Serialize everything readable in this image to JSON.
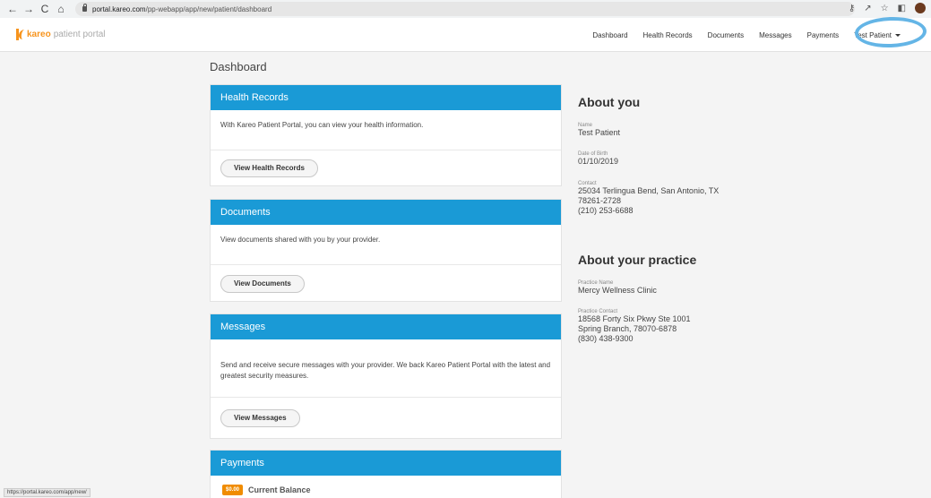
{
  "browser": {
    "url_host": "portal.kareo.com",
    "url_path": "/pp-webapp/app/new/patient/dashboard",
    "status_url": "https://portal.kareo.com/app/new/"
  },
  "app": {
    "brand": "kareo",
    "brand_suffix": "patient portal",
    "nav": [
      "Dashboard",
      "Health Records",
      "Documents",
      "Messages",
      "Payments"
    ],
    "user_name": "Test Patient"
  },
  "page": {
    "title": "Dashboard"
  },
  "cards": {
    "health_records": {
      "title": "Health Records",
      "text": "With Kareo Patient Portal, you can view your health information.",
      "button": "View Health Records"
    },
    "documents": {
      "title": "Documents",
      "text": "View documents shared with you by your provider.",
      "button": "View Documents"
    },
    "messages": {
      "title": "Messages",
      "text": "Send and receive secure messages with your provider. We back Kareo Patient Portal with the latest and greatest security measures.",
      "button": "View Messages"
    },
    "payments": {
      "title": "Payments",
      "balance_amount": "$0.00",
      "balance_label": "Current Balance"
    }
  },
  "about_you": {
    "heading": "About you",
    "name_label": "Name",
    "name": "Test Patient",
    "dob_label": "Date of Birth",
    "dob": "01/10/2019",
    "contact_label": "Contact",
    "address_line1": "25034 Terlingua Bend, San Antonio, TX",
    "address_line2": "78261-2728",
    "phone": "(210) 253-6688"
  },
  "about_practice": {
    "heading": "About your practice",
    "name_label": "Practice Name",
    "name": "Mercy Wellness Clinic",
    "contact_label": "Practice Contact",
    "address_line1": "18568 Forty Six Pkwy Ste 1001",
    "address_line2": "Spring Branch, 78070-6878",
    "phone": "(830) 438-9300"
  },
  "colors": {
    "accent": "#1a9ad6",
    "brand": "#f7941d",
    "balance_badge": "#f08c00",
    "highlight_ring": "#64b5e6"
  }
}
